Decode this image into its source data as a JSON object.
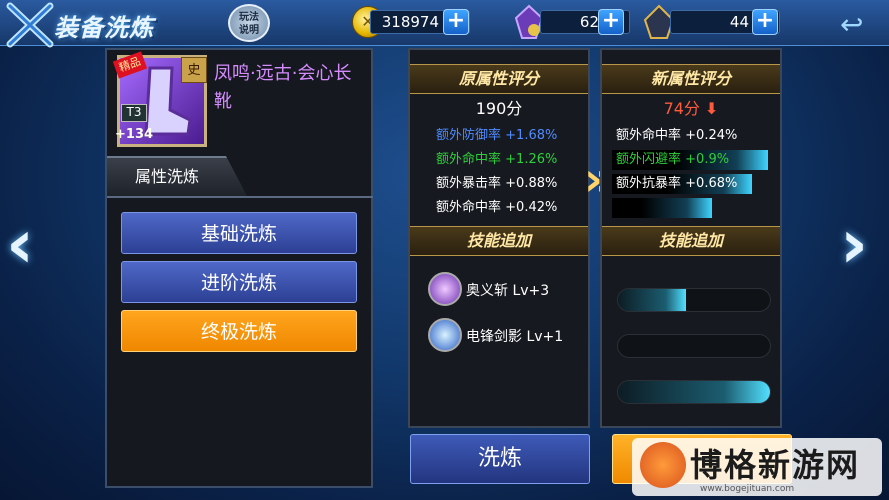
{
  "header": {
    "title": "装备洗炼",
    "help_label": "玩法\n说明"
  },
  "resources": [
    {
      "name": "gold",
      "value": "318974",
      "icon": "coin-icon"
    },
    {
      "name": "gem-purple",
      "value": "62",
      "icon": "purple-crystal-icon"
    },
    {
      "name": "gem-dark",
      "value": "44",
      "icon": "dark-crystal-icon"
    }
  ],
  "item": {
    "name": "凤鸣·远古·会心长靴",
    "quality_badge": "精品",
    "tier": "T3",
    "level": "+134",
    "grade_glyph": "史"
  },
  "left_tab": "属性洗炼",
  "wash_buttons": [
    {
      "label": "基础洗炼",
      "style": "blue"
    },
    {
      "label": "进阶洗炼",
      "style": "blue"
    },
    {
      "label": "终极洗炼",
      "style": "orange",
      "selected": true
    }
  ],
  "original": {
    "header": "原属性评分",
    "score": "190分",
    "stats": [
      {
        "name": "额外防御率",
        "value": "+1.68%",
        "color": "#4f8cff"
      },
      {
        "name": "额外命中率",
        "value": "+1.26%",
        "color": "#2fcf3c"
      },
      {
        "name": "额外暴击率",
        "value": "+0.88%",
        "color": "#ffffff"
      },
      {
        "name": "额外命中率",
        "value": "+0.42%",
        "color": "#ffffff"
      }
    ],
    "skill_header": "技能追加",
    "skills": [
      {
        "name": "奥义斩 Lv+3",
        "icon": "purple-slash-skill-icon"
      },
      {
        "name": "电锋剑影 Lv+1",
        "icon": "blue-lightning-skill-icon"
      }
    ]
  },
  "new": {
    "header": "新属性评分",
    "score": "74分",
    "trend": "down",
    "stats": [
      {
        "name": "额外命中率",
        "value": "+0.24%",
        "color": "#ffffff",
        "bar": 0.0
      },
      {
        "name": "额外闪避率",
        "value": "+0.9%",
        "color": "#2fcf3c",
        "bar": 1.0
      },
      {
        "name": "额外抗暴率",
        "value": "+0.68%",
        "color": "#ffffff",
        "bar": 0.85
      },
      {
        "name": "",
        "value": "",
        "color": "#ffffff",
        "bar": 0.55
      }
    ],
    "skill_header": "技能追加",
    "skill_bars": [
      0.45,
      0.0,
      1.0
    ]
  },
  "actions": {
    "wash": "洗炼",
    "confirm": ""
  },
  "watermark": {
    "text": "博格新游网",
    "url": "www.bogejituan.com"
  },
  "colors": {
    "accent": "#f59400",
    "panel": "#16191f",
    "gold_text": "#ffe7a5",
    "score_down": "#ff5a3c"
  }
}
